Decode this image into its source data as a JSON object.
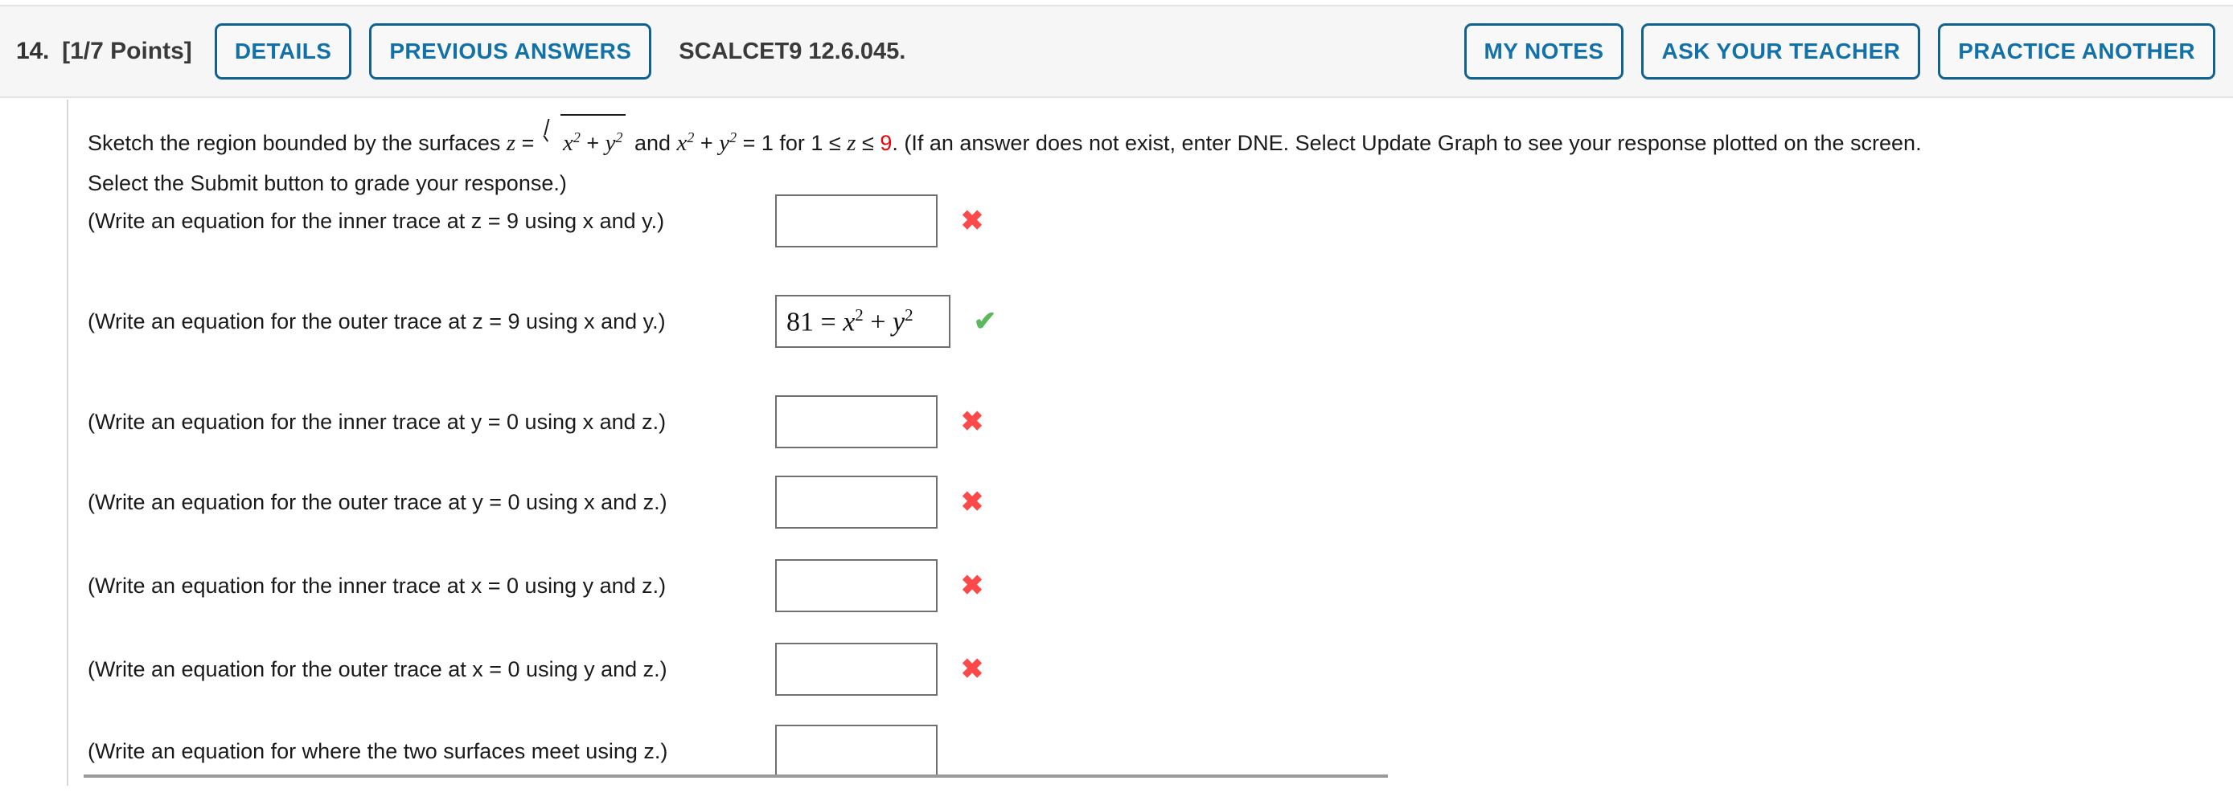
{
  "header": {
    "question_number": "14.",
    "points": "[1/7 Points]",
    "details_label": "DETAILS",
    "previous_answers_label": "PREVIOUS ANSWERS",
    "textbook_code": "SCALCET9 12.6.045.",
    "my_notes_label": "MY NOTES",
    "ask_your_teacher_label": "ASK YOUR TEACHER",
    "practice_another_label": "PRACTICE ANOTHER",
    "accent_color": "#1271a8"
  },
  "problem": {
    "line1_a": "Sketch the region bounded by the surfaces ",
    "z_var": "z",
    "eq1": " = ",
    "radicand_x": "x",
    "radicand_plus": " + ",
    "radicand_y": "y",
    "exp2": "2",
    "line1_b": " and ",
    "x_var": "x",
    "plus": " + ",
    "y_var": "y",
    "eq_one": " = 1 for 1 ≤ ",
    "z_var2": "z",
    "leq": " ≤ ",
    "z_max": "9",
    "line1_c": ". (If an answer does not exist, enter DNE. Select Update Graph to see your response plotted on the screen.",
    "line2": "Select the Submit button to grade your response.)"
  },
  "rows": [
    {
      "label": "(Write an equation for the inner trace at z = 9 using x and y.)",
      "value": "",
      "mark": "wrong",
      "mark_glyph": "✖"
    },
    {
      "label": "(Write an equation for the outer trace at z = 9 using x and y.)",
      "value": "81 = x2 + y2",
      "value_parts": {
        "lhs": "81 = ",
        "v1": "x",
        "e1": "2",
        "op": " + ",
        "v2": "y",
        "e2": "2"
      },
      "mark": "right",
      "mark_glyph": "✔"
    },
    {
      "label": "(Write an equation for the inner trace at y = 0 using x and z.)",
      "value": "",
      "mark": "wrong",
      "mark_glyph": "✖"
    },
    {
      "label": "(Write an equation for the outer trace at y = 0 using x and z.)",
      "value": "",
      "mark": "wrong",
      "mark_glyph": "✖"
    },
    {
      "label": "(Write an equation for the inner trace at x = 0 using y and z.)",
      "value": "",
      "mark": "wrong",
      "mark_glyph": "✖"
    },
    {
      "label": "(Write an equation for the outer trace at x = 0 using y and z.)",
      "value": "",
      "mark": "wrong",
      "mark_glyph": "✖"
    },
    {
      "label": "(Write an equation for where the two surfaces meet using z.)",
      "value": "",
      "mark": "none",
      "mark_glyph": ""
    }
  ],
  "colors": {
    "wrong": "#fc4a4a",
    "correct": "#5cb85c",
    "highlight_red": "#e8050c",
    "box_border": "#6f6f6f",
    "header_bg": "#f6f6f6"
  }
}
